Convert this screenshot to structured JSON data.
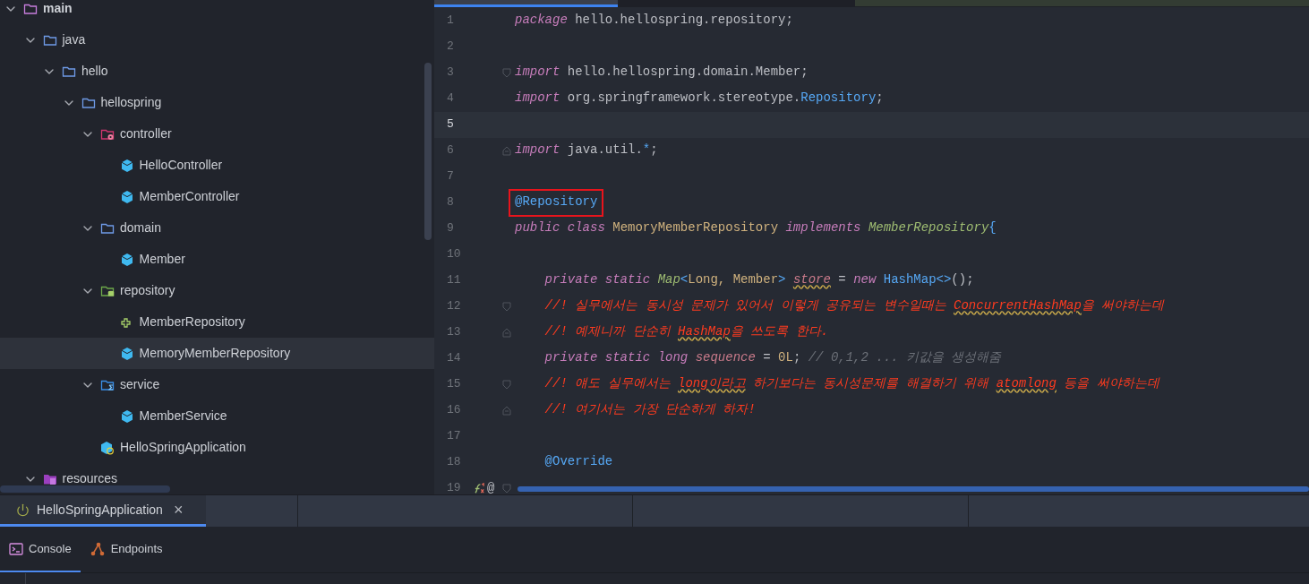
{
  "project_tree": {
    "items": [
      {
        "label": "main",
        "kind": "module",
        "expanded": true,
        "selected": false,
        "children": [
          {
            "label": "java",
            "kind": "folder",
            "expanded": true,
            "selected": false,
            "children": [
              {
                "label": "hello",
                "kind": "folder",
                "expanded": true,
                "selected": false,
                "children": [
                  {
                    "label": "hellospring",
                    "kind": "folder",
                    "expanded": true,
                    "selected": false,
                    "children": [
                      {
                        "label": "controller",
                        "kind": "controller-folder",
                        "expanded": true,
                        "selected": false,
                        "children": [
                          {
                            "label": "HelloController",
                            "kind": "class",
                            "selected": false
                          },
                          {
                            "label": "MemberController",
                            "kind": "class",
                            "selected": false
                          }
                        ]
                      },
                      {
                        "label": "domain",
                        "kind": "folder",
                        "expanded": true,
                        "selected": false,
                        "children": [
                          {
                            "label": "Member",
                            "kind": "class",
                            "selected": false
                          }
                        ]
                      },
                      {
                        "label": "repository",
                        "kind": "repository-folder",
                        "expanded": true,
                        "selected": false,
                        "children": [
                          {
                            "label": "MemberRepository",
                            "kind": "interface",
                            "selected": false
                          },
                          {
                            "label": "MemoryMemberRepository",
                            "kind": "class",
                            "selected": true
                          }
                        ]
                      },
                      {
                        "label": "service",
                        "kind": "service-folder",
                        "expanded": true,
                        "selected": false,
                        "children": [
                          {
                            "label": "MemberService",
                            "kind": "class",
                            "selected": false
                          }
                        ]
                      },
                      {
                        "label": "HelloSpringApplication",
                        "kind": "app",
                        "selected": false
                      }
                    ]
                  }
                ]
              }
            ]
          },
          {
            "label": "resources",
            "kind": "resources",
            "expanded": true,
            "selected": false
          }
        ]
      }
    ]
  },
  "editor": {
    "lines": [
      {
        "number": "1",
        "current": false,
        "boxed": false,
        "tokens": [
          {
            "text": "package",
            "kind": "keyword",
            "warn": false
          },
          {
            "text": " hello.hellospring.repository;",
            "kind": "plain",
            "warn": false
          }
        ]
      },
      {
        "number": "2",
        "current": false
      },
      {
        "number": "3",
        "current": false,
        "boxed": false,
        "fold_marker": {
          "kind": "open"
        },
        "tokens": [
          {
            "text": "import",
            "kind": "keyword",
            "warn": false
          },
          {
            "text": " hello.hellospring.domain.Member;",
            "kind": "plain",
            "warn": false
          }
        ]
      },
      {
        "number": "4",
        "current": false,
        "boxed": false,
        "tokens": [
          {
            "text": "import",
            "kind": "keyword",
            "warn": false
          },
          {
            "text": " org.springframework.stereotype.",
            "kind": "plain",
            "warn": false
          },
          {
            "text": "Repository",
            "kind": "annotation",
            "warn": false
          },
          {
            "text": ";",
            "kind": "plain",
            "warn": false
          }
        ]
      },
      {
        "number": "5",
        "current": true
      },
      {
        "number": "6",
        "current": false,
        "boxed": false,
        "fold_marker": {
          "kind": "close"
        },
        "tokens": [
          {
            "text": "import",
            "kind": "keyword",
            "warn": false
          },
          {
            "text": " java.util.",
            "kind": "plain",
            "warn": false
          },
          {
            "text": "*",
            "kind": "annotation",
            "warn": false
          },
          {
            "text": ";",
            "kind": "plain",
            "warn": false
          }
        ]
      },
      {
        "number": "7",
        "current": false
      },
      {
        "number": "8",
        "current": false,
        "boxed": true,
        "tokens": [
          {
            "text": "@Repository",
            "kind": "annotation",
            "warn": false
          }
        ]
      },
      {
        "number": "9",
        "current": false,
        "boxed": false,
        "tokens": [
          {
            "text": "public class",
            "kind": "keyword",
            "warn": false
          },
          {
            "text": " MemoryMemberRepository ",
            "kind": "class",
            "warn": false
          },
          {
            "text": "implements",
            "kind": "keyword",
            "warn": false
          },
          {
            "text": " MemberRepository",
            "kind": "interface",
            "warn": false
          },
          {
            "text": "{",
            "kind": "annotation",
            "warn": false
          }
        ]
      },
      {
        "number": "10",
        "current": false
      },
      {
        "number": "11",
        "current": false,
        "boxed": false,
        "tokens": [
          {
            "text": "    private static",
            "kind": "keyword",
            "warn": false
          },
          {
            "text": " Map",
            "kind": "interface",
            "warn": false
          },
          {
            "text": "<",
            "kind": "annotation",
            "warn": false
          },
          {
            "text": "Long, Member",
            "kind": "class",
            "warn": false
          },
          {
            "text": "> ",
            "kind": "annotation",
            "warn": false
          },
          {
            "text": "store",
            "kind": "field",
            "warn": true
          },
          {
            "text": " = ",
            "kind": "plain",
            "warn": false
          },
          {
            "text": "new",
            "kind": "keyword",
            "warn": false
          },
          {
            "text": " HashMap<>",
            "kind": "annotation",
            "warn": false
          },
          {
            "text": "();",
            "kind": "plain",
            "warn": false
          }
        ]
      },
      {
        "number": "12",
        "current": false,
        "boxed": false,
        "fold_marker": {
          "kind": "open"
        },
        "tokens": [
          {
            "text": "    //! 실무에서는 동시성 문제가 있어서 이렇게 공유되는 변수일때는 ",
            "kind": "todo",
            "warn": false
          },
          {
            "text": "ConcurrentHashMap",
            "kind": "todo",
            "warn": true
          },
          {
            "text": "을 써야하는데",
            "kind": "todo",
            "warn": false
          }
        ]
      },
      {
        "number": "13",
        "current": false,
        "boxed": false,
        "fold_marker": {
          "kind": "close"
        },
        "tokens": [
          {
            "text": "    //! 예제니까 단순히 ",
            "kind": "todo",
            "warn": false
          },
          {
            "text": "HashMap",
            "kind": "todo",
            "warn": true
          },
          {
            "text": "을 쓰도록 한다.",
            "kind": "todo",
            "warn": false
          }
        ]
      },
      {
        "number": "14",
        "current": false,
        "boxed": false,
        "tokens": [
          {
            "text": "    private static long",
            "kind": "keyword",
            "warn": false
          },
          {
            "text": " sequence",
            "kind": "field",
            "warn": false
          },
          {
            "text": " = ",
            "kind": "plain",
            "warn": false
          },
          {
            "text": "0L",
            "kind": "number",
            "warn": false
          },
          {
            "text": "; ",
            "kind": "plain",
            "warn": false
          },
          {
            "text": "// 0,1,2 ... 키값을 생성해줌",
            "kind": "comment",
            "warn": false
          }
        ]
      },
      {
        "number": "15",
        "current": false,
        "boxed": false,
        "fold_marker": {
          "kind": "open"
        },
        "tokens": [
          {
            "text": "    //! 얘도 실무에서는 ",
            "kind": "todo",
            "warn": false
          },
          {
            "text": "long이라고",
            "kind": "todo",
            "warn": true
          },
          {
            "text": " 하기보다는 동시성문제를 해결하기 위해 ",
            "kind": "todo",
            "warn": false
          },
          {
            "text": "atomlong",
            "kind": "todo",
            "warn": true
          },
          {
            "text": " 등을 써야하는데",
            "kind": "todo",
            "warn": false
          }
        ]
      },
      {
        "number": "16",
        "current": false,
        "boxed": false,
        "fold_marker": {
          "kind": "close"
        },
        "tokens": [
          {
            "text": "    //! 여기서는 가장 단순하게 하자!",
            "kind": "todo",
            "warn": false
          }
        ]
      },
      {
        "number": "17",
        "current": false
      },
      {
        "number": "18",
        "current": false,
        "boxed": false,
        "tokens": [
          {
            "text": "    @Override",
            "kind": "annotation",
            "warn": false
          }
        ]
      },
      {
        "number": "19",
        "current": false,
        "fold_marker": {
          "kind": "open"
        },
        "gutter_text": "@",
        "implements_icon": true
      }
    ]
  },
  "run_panel": {
    "tabs": [
      {
        "label": "HelloSpringApplication",
        "selected": true,
        "close": "×"
      }
    ],
    "tool_tabs": [
      {
        "label": "Console",
        "kind": "console",
        "selected": true
      },
      {
        "label": "Endpoints",
        "kind": "endpoints",
        "selected": false
      }
    ]
  }
}
